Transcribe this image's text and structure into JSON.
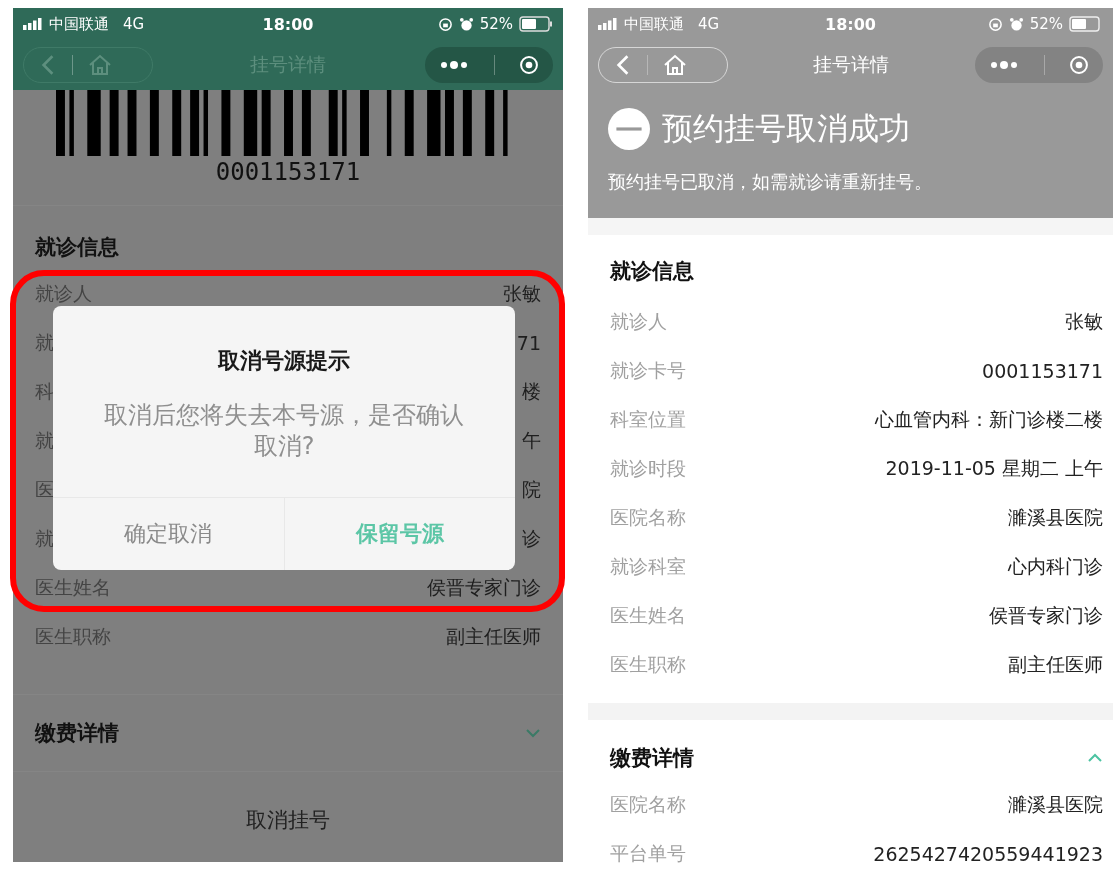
{
  "left_screen": {
    "status_bar": {
      "carrier": "中国联通",
      "network": "4G",
      "time": "18:00",
      "battery": "52%"
    },
    "nav_bar": {
      "title": "挂号详情"
    },
    "barcode": {
      "number": "0001153171"
    },
    "visit_info": {
      "title": "就诊信息",
      "rows": [
        {
          "label": "就诊人",
          "value": "张敏"
        },
        {
          "label": "就",
          "value": "71"
        },
        {
          "label": "科",
          "value": "楼"
        },
        {
          "label": "就",
          "value": "午"
        },
        {
          "label": "医",
          "value": "院"
        },
        {
          "label": "就",
          "value": "诊"
        },
        {
          "label": "医生姓名",
          "value": "侯晋专家门诊"
        },
        {
          "label": "医生职称",
          "value": "副主任医师"
        }
      ]
    },
    "payment": {
      "title": "缴费详情",
      "expanded": false
    },
    "cancel_button": "取消挂号",
    "dialog": {
      "title": "取消号源提示",
      "message": "取消后您将失去本号源，是否确认取消?",
      "buttons": [
        {
          "label": "确定取消",
          "kind": "secondary"
        },
        {
          "label": "保留号源",
          "kind": "primary"
        }
      ]
    }
  },
  "right_screen": {
    "status_bar": {
      "carrier": "中国联通",
      "network": "4G",
      "time": "18:00",
      "battery": "52%"
    },
    "nav_bar": {
      "title": "挂号详情"
    },
    "result": {
      "title": "预约挂号取消成功",
      "message": "预约挂号已取消，如需就诊请重新挂号。"
    },
    "visit_info": {
      "title": "就诊信息",
      "rows": [
        {
          "label": "就诊人",
          "value": "张敏"
        },
        {
          "label": "就诊卡号",
          "value": "0001153171"
        },
        {
          "label": "科室位置",
          "value": "心血管内科：新门诊楼二楼"
        },
        {
          "label": "就诊时段",
          "value": "2019-11-05 星期二 上午"
        },
        {
          "label": "医院名称",
          "value": "濉溪县医院"
        },
        {
          "label": "就诊科室",
          "value": "心内科门诊"
        },
        {
          "label": "医生姓名",
          "value": "侯晋专家门诊"
        },
        {
          "label": "医生职称",
          "value": "副主任医师"
        }
      ]
    },
    "payment": {
      "title": "缴费详情",
      "expanded": true,
      "rows": [
        {
          "label": "医院名称",
          "value": "濉溪县医院"
        },
        {
          "label": "平台单号",
          "value": "2625427420559441923"
        }
      ]
    }
  }
}
